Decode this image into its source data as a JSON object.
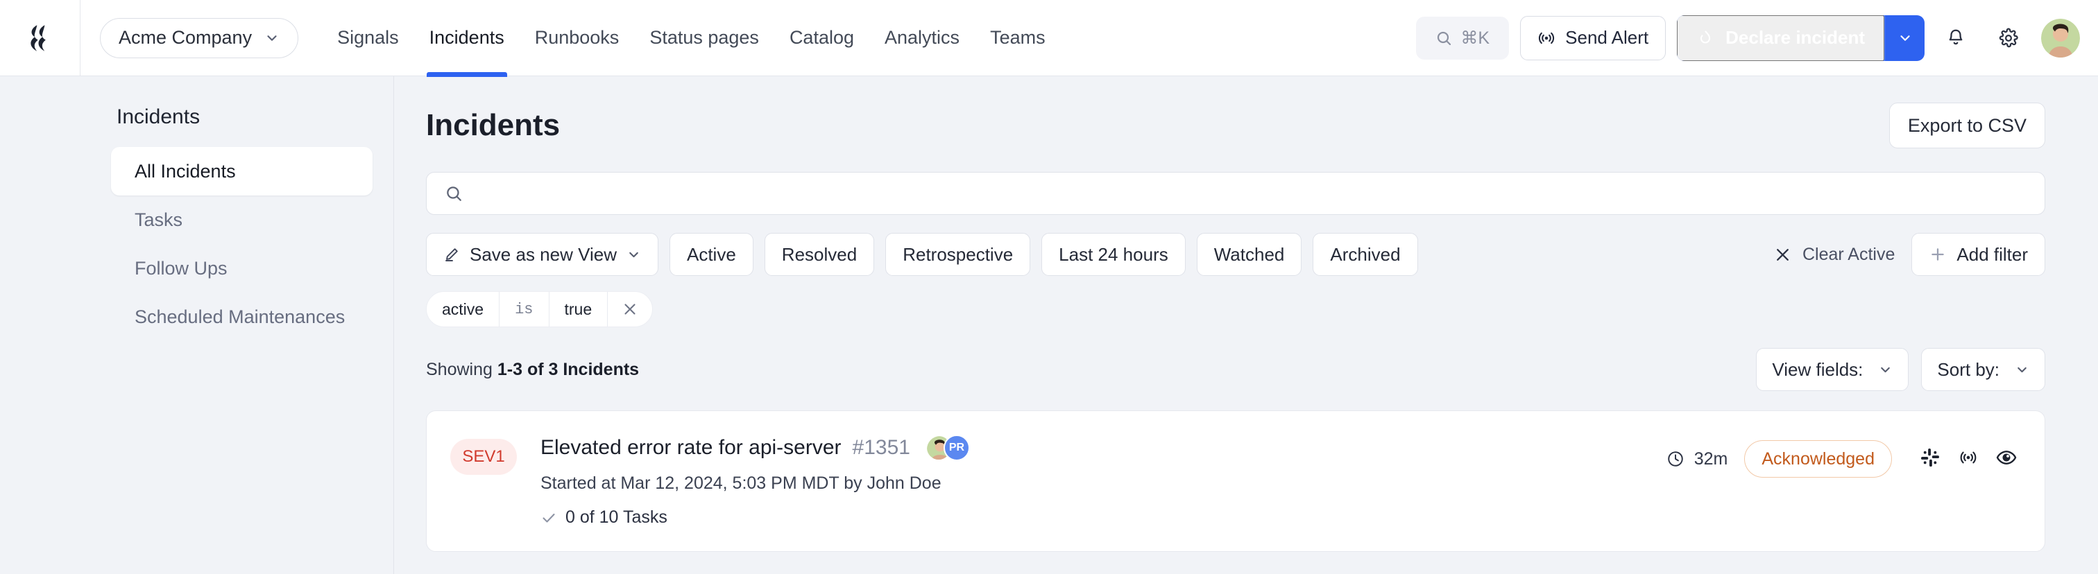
{
  "topbar": {
    "logo_icon": "firehydrant-logo",
    "org_switcher": {
      "label": "Acme Company",
      "caret_icon": "chevron-down-icon"
    },
    "nav": [
      {
        "label": "Signals",
        "active": false
      },
      {
        "label": "Incidents",
        "active": true
      },
      {
        "label": "Runbooks",
        "active": false
      },
      {
        "label": "Status pages",
        "active": false
      },
      {
        "label": "Catalog",
        "active": false
      },
      {
        "label": "Analytics",
        "active": false
      },
      {
        "label": "Teams",
        "active": false
      }
    ],
    "search_shortcut": {
      "icon": "search-icon",
      "label": "⌘K"
    },
    "send_alert": {
      "label": "Send Alert",
      "icon": "broadcast-icon"
    },
    "declare_incident": {
      "label": "Declare incident",
      "icon": "flame-icon",
      "caret_icon": "chevron-down-icon",
      "accent": "#2e62f0"
    },
    "notifications_icon": "bell-icon",
    "settings_icon": "gear-icon",
    "avatar": "user-avatar"
  },
  "sidebar": {
    "title": "Incidents",
    "items": [
      {
        "label": "All Incidents",
        "selected": true
      },
      {
        "label": "Tasks",
        "selected": false
      },
      {
        "label": "Follow Ups",
        "selected": false
      },
      {
        "label": "Scheduled Maintenances",
        "selected": false
      }
    ]
  },
  "main": {
    "page_title": "Incidents",
    "export_label": "Export to CSV",
    "search": {
      "value": "",
      "placeholder": "",
      "icon": "search-icon"
    },
    "filters": {
      "save_view": {
        "label": "Save as new View",
        "icon": "pencil-icon",
        "caret_icon": "chevron-down-icon"
      },
      "pills": [
        "Active",
        "Resolved",
        "Retrospective",
        "Last 24 hours",
        "Watched",
        "Archived"
      ],
      "clear": {
        "label": "Clear Active",
        "icon": "close-icon"
      },
      "add_filter": {
        "label": "Add filter",
        "icon": "plus-icon"
      }
    },
    "active_chip": {
      "field": "active",
      "operator": "is",
      "value": "true",
      "remove_icon": "close-icon"
    },
    "showing": {
      "prefix": "Showing",
      "range": "1-3 of 3 Incidents"
    },
    "view_fields": {
      "label": "View fields:",
      "caret_icon": "chevron-down-icon"
    },
    "sort_by": {
      "label": "Sort by:",
      "caret_icon": "chevron-down-icon"
    },
    "incidents": [
      {
        "severity": "SEV1",
        "title": "Elevated error rate for api-server",
        "number": "#1351",
        "assignees": [
          "user-photo",
          "PR"
        ],
        "subtitle": "Started at Mar 12, 2024, 5:03 PM MDT by John Doe",
        "tasks": "0 of 10 Tasks",
        "tasks_icon": "check-icon",
        "duration": "32m",
        "duration_icon": "clock-icon",
        "status": "Acknowledged",
        "status_color": "#c25a1c",
        "icons": [
          "slack-icon",
          "broadcast-icon",
          "eye-icon"
        ]
      }
    ]
  }
}
